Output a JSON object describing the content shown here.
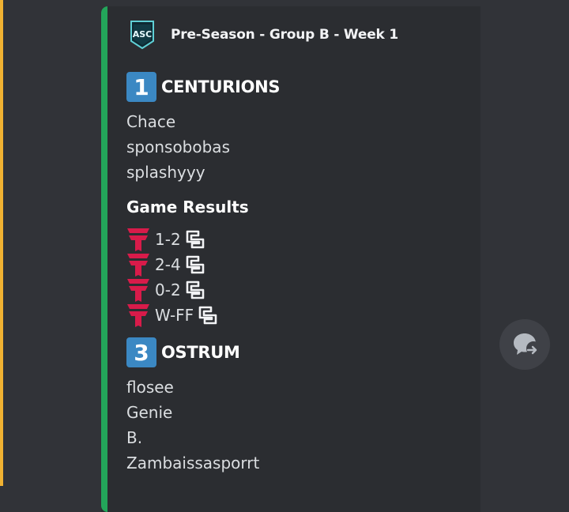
{
  "embed": {
    "author_name": "Pre-Season - Group B - Week 1",
    "author_logo_text": "ASC",
    "accent_color": "#23a55a"
  },
  "teams": [
    {
      "rank": "1",
      "name": "CENTURIONS",
      "players": [
        "Chace",
        "sponsobobas",
        "splashyyy"
      ]
    },
    {
      "rank": "3",
      "name": "OSTRUM",
      "players": [
        "flosee",
        "Genie",
        "B.",
        "Zambaissasporrt"
      ]
    }
  ],
  "game_results": {
    "title": "Game Results",
    "rows": [
      {
        "score": "1-2",
        "team_icon": "centurions-t-icon",
        "opponent_icon": "ostrum-logo-icon"
      },
      {
        "score": "2-4",
        "team_icon": "centurions-t-icon",
        "opponent_icon": "ostrum-logo-icon"
      },
      {
        "score": "0-2",
        "team_icon": "centurions-t-icon",
        "opponent_icon": "ostrum-logo-icon"
      },
      {
        "score": "W-FF",
        "team_icon": "centurions-t-icon",
        "opponent_icon": "ostrum-logo-icon"
      }
    ]
  },
  "floating_button": {
    "icon": "open-thread-icon"
  }
}
